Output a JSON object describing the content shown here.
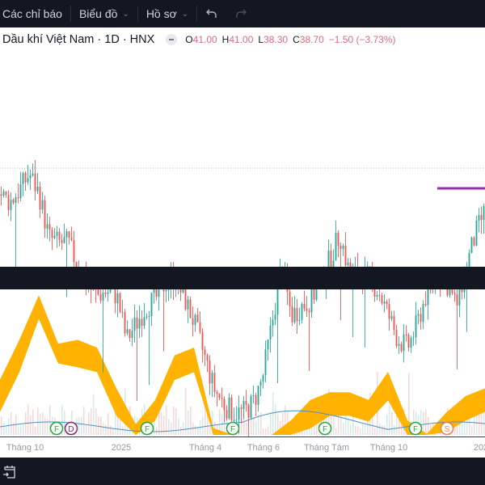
{
  "toolbar": {
    "indicators_label": "Các chỉ báo",
    "chart_label": "Biểu đồ",
    "profile_label": "Hồ sơ",
    "undo_icon": "undo-icon",
    "redo_icon": "redo-icon"
  },
  "legend": {
    "symbol": "Dầu khí Việt Nam · 1D · HNX",
    "o_label": "O",
    "o": "41.00",
    "h_label": "H",
    "h": "41.00",
    "l_label": "L",
    "l": "38.30",
    "c_label": "C",
    "c": "38.70",
    "change": "−1.50 (−3.73%)"
  },
  "colors": {
    "up": "#26a69a",
    "down": "#ef5350",
    "cloud": "#ffb300",
    "ma": "#4a90c2",
    "purple_line": "#9c27b0",
    "toolbar_bg": "#131722",
    "marker_f": "#22a83a",
    "marker_d": "#8e1f6b",
    "marker_s": "#f08040"
  },
  "time_axis": [
    "Tháng 10",
    "2025",
    "Tháng 4",
    "Tháng 6",
    "Tháng Tám",
    "Tháng 10",
    "202"
  ],
  "markers": [
    {
      "label": "F",
      "type": "f"
    },
    {
      "label": "D",
      "type": "d"
    },
    {
      "label": "F",
      "type": "f"
    },
    {
      "label": "F",
      "type": "f"
    },
    {
      "label": "F",
      "type": "f"
    },
    {
      "label": "F",
      "type": "f"
    },
    {
      "label": "S",
      "type": "s"
    }
  ],
  "chart_data": {
    "type": "candlestick",
    "closes": [
      41.3,
      40.5,
      41.8,
      43.4,
      41.3,
      36.8,
      36.3,
      36.3,
      33.8,
      31.8,
      30.9,
      31.3,
      30.9,
      26.3,
      28.0,
      29.7,
      30.5,
      32.2,
      32.6,
      30.5,
      28.0,
      24.7,
      21.3,
      19.7,
      18.8,
      18.8,
      19.7,
      22.2,
      28.0,
      33.8,
      28.8,
      29.7,
      30.5,
      32.2,
      34.7,
      37.2,
      33.0,
      33.0,
      32.6,
      31.3,
      28.8,
      26.3,
      25.5,
      28.0,
      31.3,
      33.0,
      32.2,
      29.7,
      33.8,
      37.2,
      39.7
    ],
    "cloud": [
      [
        22.2,
        19.7
      ],
      [
        26.3,
        23.8
      ],
      [
        30.9,
        29.3
      ],
      [
        25.9,
        24.7
      ],
      [
        26.3,
        24.3
      ],
      [
        25.5,
        23.8
      ],
      [
        21.3,
        19.3
      ],
      [
        17.6,
        16.5
      ],
      [
        20.1,
        18.8
      ],
      [
        24.7,
        23.0
      ],
      [
        25.5,
        23.8
      ],
      [
        17.2,
        16.5
      ],
      [
        16.5,
        16.5
      ],
      [
        16.5,
        16.5
      ],
      [
        16.5,
        16.5
      ],
      [
        18.0,
        16.8
      ],
      [
        20.1,
        18.0
      ],
      [
        20.9,
        19.3
      ],
      [
        20.9,
        19.3
      ],
      [
        20.1,
        18.7
      ],
      [
        23.0,
        20.9
      ],
      [
        18.0,
        16.5
      ],
      [
        16.6,
        16.5
      ],
      [
        18.8,
        17.6
      ],
      [
        20.5,
        18.8
      ],
      [
        21.3,
        19.7
      ]
    ],
    "last_high": 41.0,
    "last_low": 38.3,
    "last_close": 38.7
  }
}
